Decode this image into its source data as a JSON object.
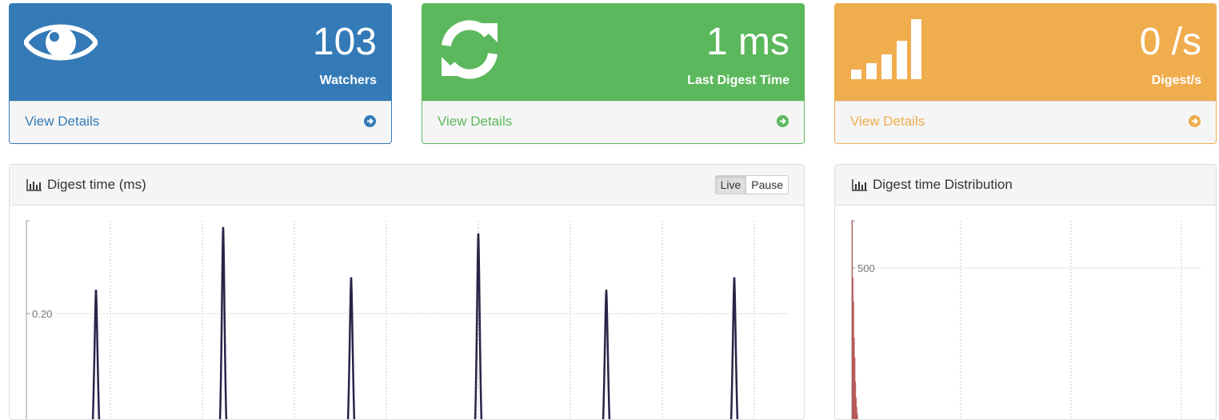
{
  "stats": [
    {
      "value": "103",
      "label": "Watchers",
      "link": "View Details",
      "icon": "eye-icon",
      "color": "#337ab7"
    },
    {
      "value": "1 ms",
      "label": "Last Digest Time",
      "link": "View Details",
      "icon": "refresh-icon",
      "color": "#5cb85c"
    },
    {
      "value": "0 /s",
      "label": "Digest/s",
      "link": "View Details",
      "icon": "signal-icon",
      "color": "#f0ad4e"
    }
  ],
  "digest_chart": {
    "title": "Digest time (ms)",
    "buttons": {
      "live": "Live",
      "pause": "Pause"
    }
  },
  "distribution_chart": {
    "title": "Digest time Distribution"
  },
  "chart_data": [
    {
      "type": "line",
      "title": "Digest time (ms)",
      "y_tick_labels": [
        "0.20"
      ],
      "ylim": [
        0,
        0.32
      ],
      "grid": true,
      "color": "#2a2346",
      "spikes": [
        {
          "peak": 0.21
        },
        {
          "peak": 0.31
        },
        {
          "peak": 0.23
        },
        {
          "peak": 0.3
        },
        {
          "peak": 0.21
        },
        {
          "peak": 0.23
        }
      ]
    },
    {
      "type": "bar",
      "title": "Digest time Distribution",
      "y_tick_labels": [
        "500"
      ],
      "ylim": [
        0,
        790
      ],
      "grid": true,
      "color": "#b24a4a"
    }
  ]
}
